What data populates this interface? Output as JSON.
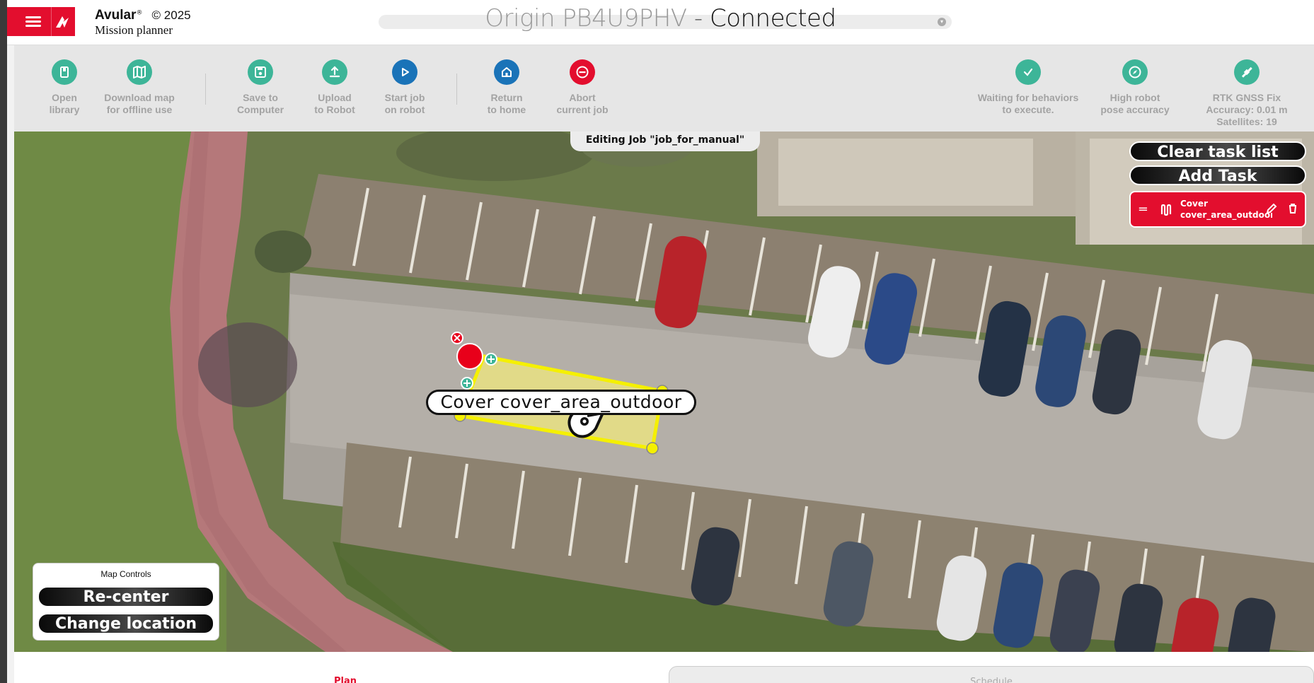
{
  "header": {
    "brand_name": "Avular",
    "brand_reg": "®",
    "brand_copyright": "© 2025",
    "brand_subtitle": "Mission planner",
    "robot_name": "Origin PB4U9PHV",
    "robot_separator": "-",
    "robot_state": "Connected"
  },
  "toolbar": {
    "left": [
      {
        "label": "Open\nlibrary",
        "icon": "book-icon",
        "color": "#3db598"
      },
      {
        "label": "Download map\nfor offline use",
        "icon": "map-icon",
        "color": "#3db598"
      },
      {
        "label": "Save to\nComputer",
        "icon": "save-icon",
        "color": "#3db598"
      },
      {
        "label": "Upload\nto Robot",
        "icon": "upload-icon",
        "color": "#3db598"
      },
      {
        "label": "Start job\non robot",
        "icon": "play-icon",
        "color": "#1a73b8"
      },
      {
        "label": "Return\nto home",
        "icon": "home-icon",
        "color": "#1a73b8"
      },
      {
        "label": "Abort\ncurrent job",
        "icon": "stop-icon",
        "color": "#e30e2e"
      }
    ],
    "status": [
      {
        "label": "Waiting for behaviors\nto execute.",
        "icon": "check-icon",
        "color": "#3db598"
      },
      {
        "label": "High robot\npose accuracy",
        "icon": "compass-icon",
        "color": "#3db598"
      },
      {
        "label": "RTK GNSS Fix\nAccuracy: 0.01 m\nSatellites: 19",
        "icon": "satellite-icon",
        "color": "#3db598"
      }
    ]
  },
  "editor": {
    "job_tab": "Editing Job \"job_for_manual\"",
    "clear_label": "Clear task list",
    "add_label": "Add Task",
    "task": {
      "type": "Cover",
      "name": "cover_area_outdoor"
    },
    "area_label": "Cover cover_area_outdoor"
  },
  "map_controls": {
    "title": "Map Controls",
    "recenter": "Re-center",
    "change_location": "Change location"
  },
  "bottom_tabs": {
    "plan": "Plan",
    "schedule": "Schedule"
  },
  "colors": {
    "brand_red": "#e30e2e",
    "teal": "#3db598",
    "blue": "#1a73b8",
    "area_yellow": "#f5f000"
  }
}
